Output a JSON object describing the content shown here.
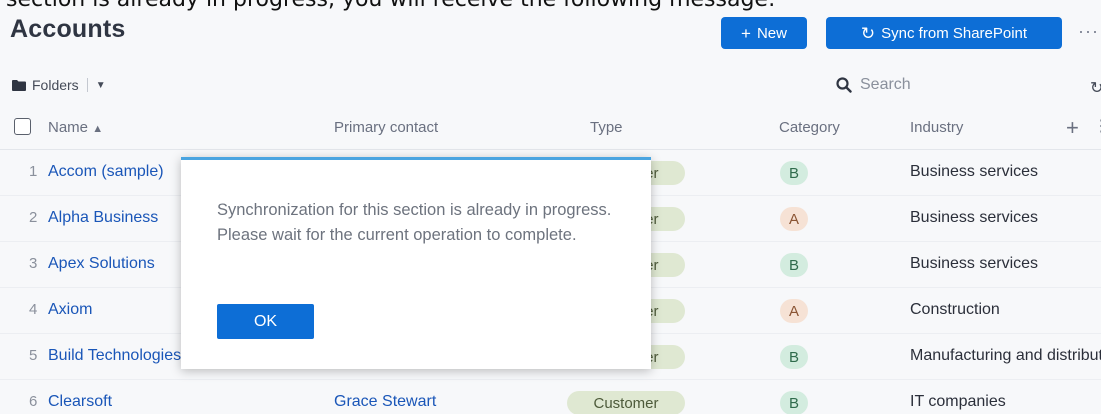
{
  "caption": "section is already in progress, you will receive the following message:",
  "header": {
    "title": "Accounts",
    "new_label": "New",
    "sync_label": "Sync from SharePoint",
    "more_icon": "ellipsis-icon"
  },
  "toolbar": {
    "folders_label": "Folders",
    "search_placeholder": "Search"
  },
  "table": {
    "columns": [
      "Name",
      "Primary contact",
      "Type",
      "Category",
      "Industry"
    ],
    "rows": [
      {
        "num": "1",
        "name": "Accom (sample)",
        "contact": "",
        "type": "Customer",
        "category": "B",
        "industry": "Business services"
      },
      {
        "num": "2",
        "name": "Alpha Business",
        "contact": "",
        "type": "Customer",
        "category": "A",
        "industry": "Business services"
      },
      {
        "num": "3",
        "name": "Apex Solutions",
        "contact": "",
        "type": "Customer",
        "category": "B",
        "industry": "Business services"
      },
      {
        "num": "4",
        "name": "Axiom",
        "contact": "",
        "type": "Customer",
        "category": "A",
        "industry": "Construction"
      },
      {
        "num": "5",
        "name": "Build Technologies",
        "contact": "",
        "type": "Customer",
        "category": "B",
        "industry": "Manufacturing and distribution"
      },
      {
        "num": "6",
        "name": "Clearsoft",
        "contact": "Grace Stewart",
        "type": "Customer",
        "category": "B",
        "industry": "IT companies"
      }
    ]
  },
  "dialog": {
    "message": "Synchronization for this section is already in progress. Please wait for the current operation to complete.",
    "ok_label": "OK"
  },
  "colors": {
    "primary": "#0d6ed6",
    "link": "#1a56b8",
    "dialog_accent": "#49a4e0",
    "type_pill_bg": "#dfe8d2",
    "category_b_bg": "#d3ecdf",
    "category_a_bg": "#f6e2d5"
  }
}
